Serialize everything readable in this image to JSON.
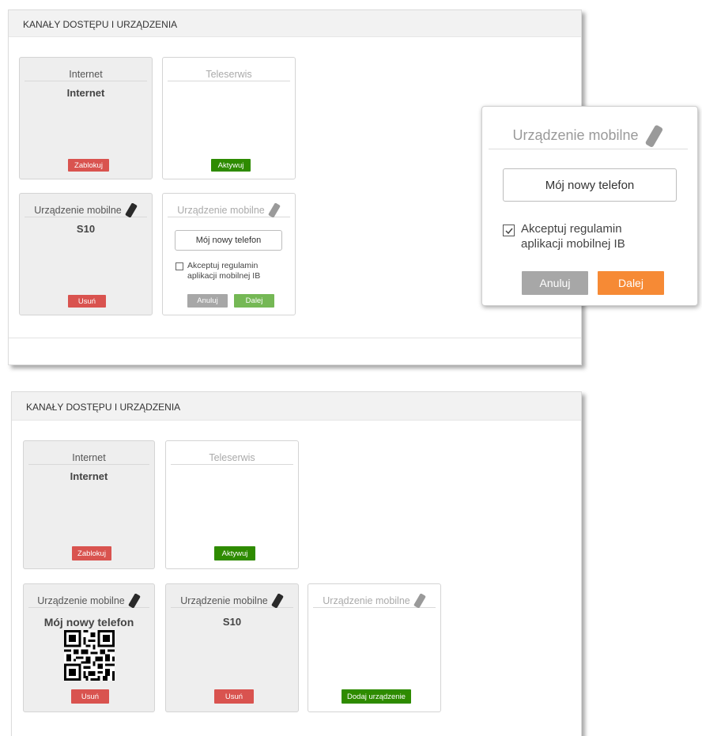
{
  "panel_title": "KANAŁY DOSTĘPU I URZĄDZENIA",
  "top": {
    "internet": {
      "title": "Internet",
      "value": "Internet",
      "button": "Zablokuj"
    },
    "teleserwis": {
      "title": "Teleserwis",
      "button": "Aktywuj"
    },
    "mobile_existing": {
      "title": "Urządzenie mobilne",
      "value": "S10",
      "button": "Usuń"
    },
    "mobile_form": {
      "title": "Urządzenie mobilne",
      "input_value": "Mój nowy telefon",
      "checkbox_label_1": "Akceptuj regulamin",
      "checkbox_label_2": "aplikacji mobilnej IB",
      "cancel": "Anuluj",
      "next": "Dalej"
    }
  },
  "zoom": {
    "title": "Urządzenie mobilne",
    "input_value": "Mój nowy telefon",
    "checkbox_label_1": "Akceptuj regulamin",
    "checkbox_label_2": "aplikacji mobilnej IB",
    "cancel": "Anuluj",
    "next": "Dalej"
  },
  "bottom": {
    "internet": {
      "title": "Internet",
      "value": "Internet",
      "button": "Zablokuj"
    },
    "teleserwis": {
      "title": "Teleserwis",
      "button": "Aktywuj"
    },
    "mobile_new": {
      "title": "Urządzenie mobilne",
      "value": "Mój nowy telefon",
      "button": "Usuń"
    },
    "mobile_s10": {
      "title": "Urządzenie mobilne",
      "value": "S10",
      "button": "Usuń"
    },
    "mobile_add": {
      "title": "Urządzenie mobilne",
      "button": "Dodaj urządzenie"
    }
  },
  "colors": {
    "red": "#d9534f",
    "green": "#2e8b00",
    "light_green": "#75b855",
    "gray_button": "#a7a7a7",
    "orange": "#f68a35",
    "card_gray": "#eeeeee"
  },
  "icons": {
    "phone": "mobile-phone-icon",
    "checkbox": "checkbox-checked-icon",
    "qr": "qr-code-icon"
  }
}
